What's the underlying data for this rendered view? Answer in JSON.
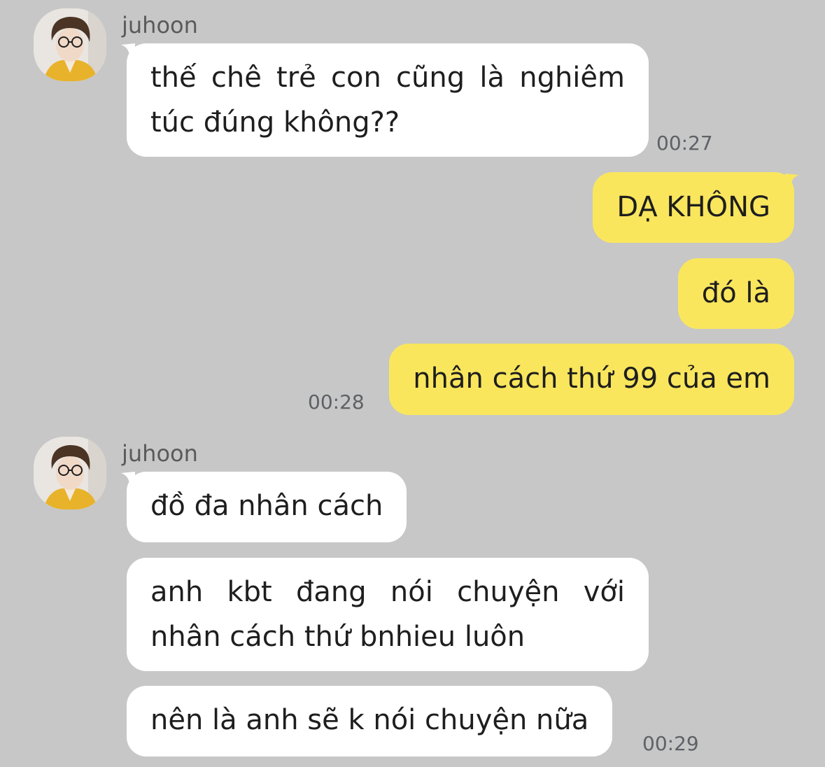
{
  "colors": {
    "background": "#c7c7c7",
    "incoming_bubble": "#ffffff",
    "outgoing_bubble": "#f9e65d",
    "timestamp": "#5e6166"
  },
  "messages": [
    {
      "direction": "incoming",
      "sender": "juhoon",
      "lines": [
        "thế chê trẻ con cũng là nghiêm",
        "túc đúng không??"
      ],
      "time": "00:27"
    },
    {
      "direction": "outgoing",
      "text": "DẠ KHÔNG"
    },
    {
      "direction": "outgoing",
      "text": "đó là"
    },
    {
      "direction": "outgoing",
      "text": "nhân cách thứ 99 của em",
      "time": "00:28"
    },
    {
      "direction": "incoming",
      "sender": "juhoon",
      "lines": [
        "đồ đa nhân cách"
      ]
    },
    {
      "direction": "incoming",
      "lines": [
        "anh kbt đang nói chuyện với",
        "nhân cách thứ bnhieu luôn"
      ]
    },
    {
      "direction": "incoming",
      "lines": [
        "nên là anh sẽ k nói chuyện nữa"
      ],
      "time": "00:29"
    }
  ]
}
